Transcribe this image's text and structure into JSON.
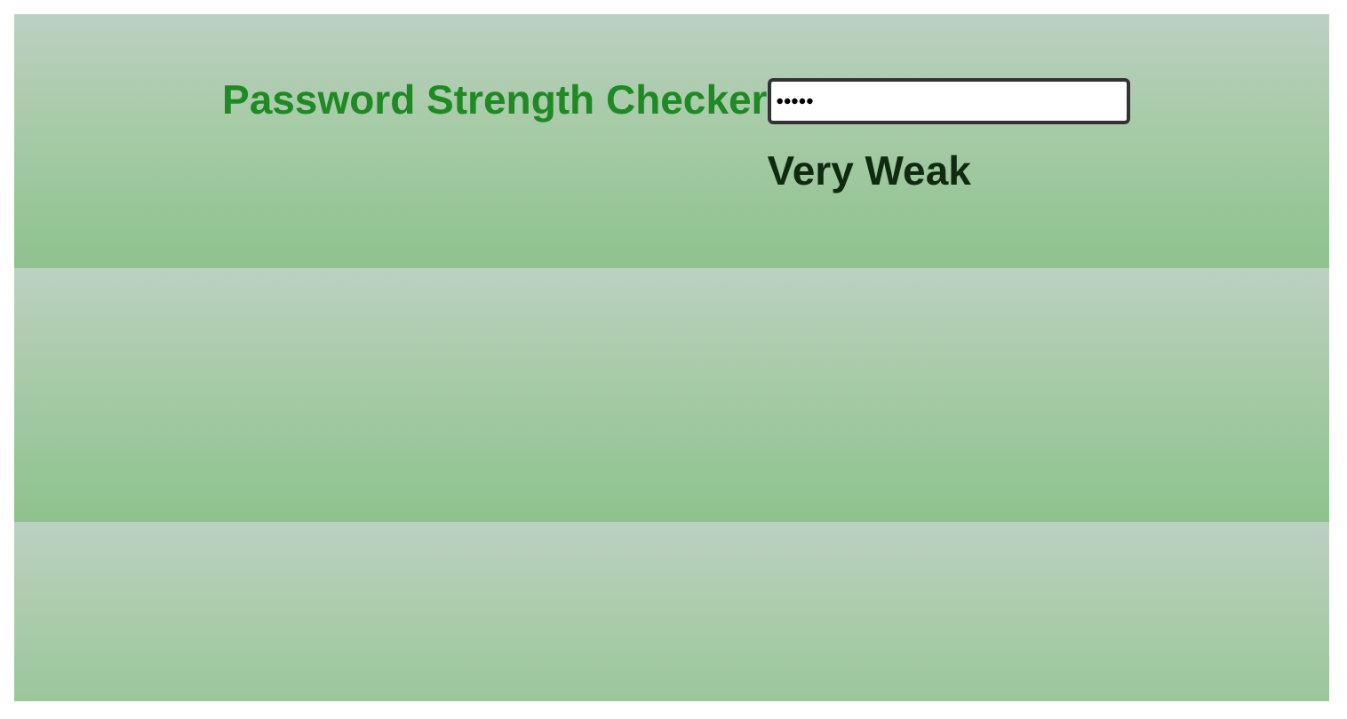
{
  "title": "Password Strength Checker",
  "password": {
    "value": "•••••"
  },
  "strength": "Very Weak"
}
